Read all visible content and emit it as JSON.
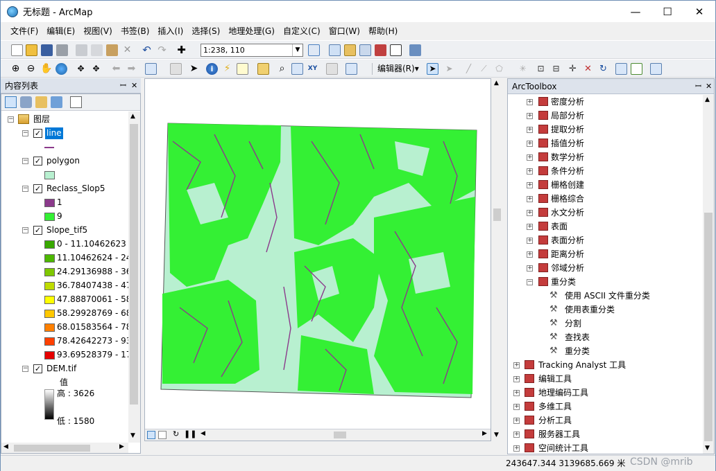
{
  "window": {
    "title": "无标题 - ArcMap"
  },
  "menu": [
    "文件(F)",
    "编辑(E)",
    "视图(V)",
    "书签(B)",
    "插入(I)",
    "选择(S)",
    "地理处理(G)",
    "自定义(C)",
    "窗口(W)",
    "帮助(H)"
  ],
  "toolbar": {
    "scale_value": "1:238, 110",
    "editor_label": "编辑器(R)▾"
  },
  "toc": {
    "title": "内容列表",
    "pin": "ꟷ ✕",
    "root_label": "图层",
    "layers": [
      {
        "name": "line"
      },
      {
        "name": "polygon"
      },
      {
        "name": "Reclass_Slop5",
        "classes": [
          "1",
          "9"
        ]
      },
      {
        "name": "Slope_tif5",
        "classes": [
          "0 - 11.10462623",
          "11.10462624 - 24.",
          "24.29136988 - 36.",
          "36.78407438 - 47.",
          "47.88870061 - 58.",
          "58.29928769 - 68.",
          "68.01583564 - 78.",
          "78.42642273 - 93.",
          "93.69528379 - 17("
        ]
      },
      {
        "name": "DEM.tif",
        "value_label": "值",
        "high_label": "高 : 3626",
        "low_label": "低 : 1580"
      }
    ]
  },
  "arctoolbox": {
    "title": "ArcToolbox",
    "spatial_analyst_items": [
      "密度分析",
      "局部分析",
      "提取分析",
      "插值分析",
      "数学分析",
      "条件分析",
      "栅格创建",
      "栅格综合",
      "水文分析",
      "表面",
      "表面分析",
      "距离分析",
      "邻域分析"
    ],
    "reclass_label": "重分类",
    "reclass_tools": [
      "使用 ASCII 文件重分类",
      "使用表重分类",
      "分割",
      "查找表",
      "重分类"
    ],
    "toolboxes": [
      "Tracking Analyst 工具",
      "编辑工具",
      "地理编码工具",
      "多维工具",
      "分析工具",
      "服务器工具",
      "空间统计工具"
    ]
  },
  "status": {
    "coords": "243647.344  3139685.669 米",
    "watermark": "CSDN @mrib"
  },
  "colors": {
    "accent": "#0078d7",
    "reclass_1": "#8b3a8b",
    "reclass_9": "#34f034",
    "polygon_fill": "#b8f0d0",
    "slope_ramp": [
      "#38a800",
      "#4db800",
      "#7fc800",
      "#bfdc00",
      "#ffff00",
      "#ffc800",
      "#ff8000",
      "#ff4000",
      "#e60000"
    ]
  }
}
